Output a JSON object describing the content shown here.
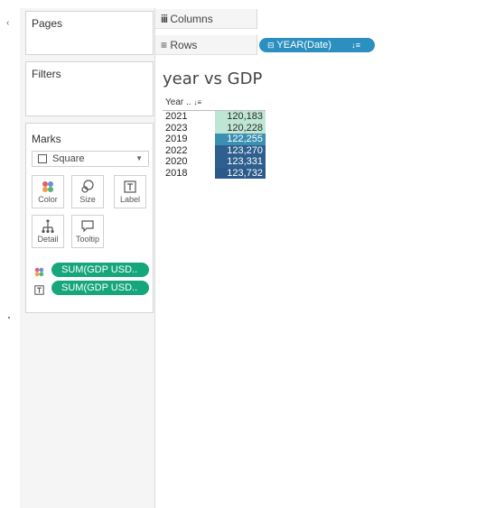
{
  "left_panel": {
    "pages_title": "Pages",
    "filters_title": "Filters",
    "marks": {
      "title": "Marks",
      "mark_type": "Square",
      "buttons": [
        {
          "label": "Color",
          "icon": "color-dots-icon"
        },
        {
          "label": "Size",
          "icon": "size-icon"
        },
        {
          "label": "Label",
          "icon": "label-T-icon"
        },
        {
          "label": "Detail",
          "icon": "detail-icon"
        },
        {
          "label": "Tooltip",
          "icon": "tooltip-icon"
        }
      ],
      "fields": [
        {
          "label": "SUM(GDP USD..",
          "encoding_icon": "color-dots-icon"
        },
        {
          "label": "SUM(GDP USD..",
          "encoding_icon": "label-T-icon"
        }
      ]
    }
  },
  "shelves": {
    "columns_label": "Columns",
    "rows_label": "Rows",
    "rows_pill": "YEAR(Date)"
  },
  "view": {
    "title": "year vs GDP",
    "column_header": "Year ..",
    "rows": [
      {
        "year": "2021",
        "value": "120,183",
        "color": "#bfe6d5",
        "text_color": "#2a2a2a"
      },
      {
        "year": "2023",
        "value": "120,228",
        "color": "#bfe6d5",
        "text_color": "#2a2a2a"
      },
      {
        "year": "2019",
        "value": "122,255",
        "color": "#3b8fb0",
        "text_color": "#ffffff"
      },
      {
        "year": "2022",
        "value": "123,270",
        "color": "#2e5f8e",
        "text_color": "#ffffff"
      },
      {
        "year": "2020",
        "value": "123,331",
        "color": "#2e5f8e",
        "text_color": "#ffffff"
      },
      {
        "year": "2018",
        "value": "123,732",
        "color": "#2a5a8a",
        "text_color": "#ffffff"
      }
    ]
  },
  "colors": {
    "measure_pill": "#16a67c",
    "dimension_pill": "#2b8fbf"
  }
}
